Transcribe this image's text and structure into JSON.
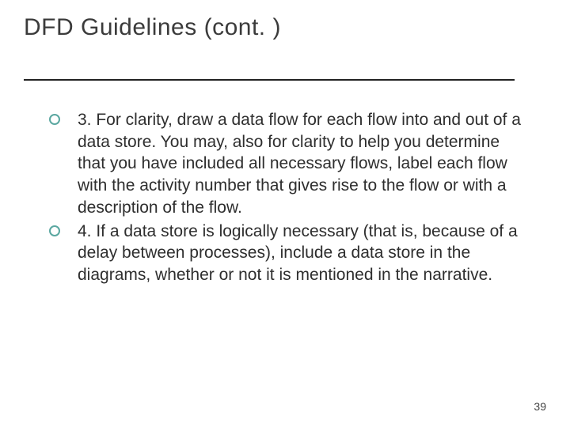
{
  "slide": {
    "title": "DFD Guidelines (cont. )",
    "items": [
      {
        "text": "3. For clarity, draw a data flow for each flow into and out of a data store. You may, also for clarity to help you determine that you have included all necessary flows, label each flow with the activity number that gives rise to the flow or with a description of the flow."
      },
      {
        "text": "4. If a data store is logically necessary (that is, because of a delay between processes), include a data store in the diagrams, whether or not it is mentioned in the narrative."
      }
    ],
    "page_number": "39"
  }
}
